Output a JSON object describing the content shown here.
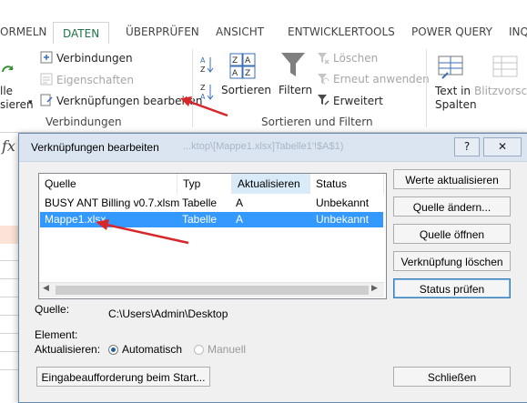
{
  "ribbon": {
    "tabs": [
      "ORMELN",
      "DATEN",
      "ÜBERPRÜFEN",
      "ANSICHT",
      "ENTWICKLERTOOLS",
      "POWER QUERY",
      "INQ"
    ],
    "connections": {
      "verbindungen": "Verbindungen",
      "eigenschaften": "Eigenschaften",
      "verknuepfungen": "Verknüpfungen bearbeiten",
      "group_label": "Verbindungen"
    },
    "left_partial": {
      "line1": "lle",
      "line2": "sieren"
    },
    "sort_filter": {
      "sortieren": "Sortieren",
      "filtern": "Filtern",
      "loeschen": "Löschen",
      "erneut": "Erneut anwenden",
      "erweitert": "Erweitert",
      "group_label": "Sortieren und Filtern"
    },
    "tools": {
      "text_in_spalten_1": "Text in",
      "text_in_spalten_2": "Spalten",
      "blitzvorschau": "Blitzvorscha"
    }
  },
  "formula_bar": {
    "fx": "fx",
    "path_hint": "...ktop\\[Mappe1.xlsx]Tabelle1'!$A$1)"
  },
  "dialog": {
    "title": "Verknüpfungen bearbeiten",
    "help": "?",
    "close": "✕",
    "columns": [
      "Quelle",
      "Typ",
      "Aktualisieren",
      "Status"
    ],
    "rows": [
      {
        "quelle": "BUSY ANT Billing v0.7.xlsm",
        "typ": "Tabelle",
        "aktualisieren": "A",
        "status": "Unbekannt"
      },
      {
        "quelle": "Mappe1.xlsx",
        "typ": "Tabelle",
        "aktualisieren": "A",
        "status": "Unbekannt"
      }
    ],
    "buttons": {
      "werte": "Werte aktualisieren",
      "quelle_aendern": "Quelle ändern...",
      "quelle_oeffnen": "Quelle öffnen",
      "loeschen": "Verknüpfung löschen",
      "status": "Status prüfen",
      "eingabe": "Eingabeaufforderung beim Start...",
      "schliessen": "Schließen"
    },
    "quelle_label": "Quelle:",
    "quelle_value": "C:\\Users\\Admin\\Desktop",
    "element_label": "Element:",
    "aktualisieren_label": "Aktualisieren:",
    "radio_auto": "Automatisch",
    "radio_manual": "Manuell"
  },
  "colors": {
    "accent": "#217346",
    "selection": "#3399ff",
    "arrow": "#d9262b"
  }
}
